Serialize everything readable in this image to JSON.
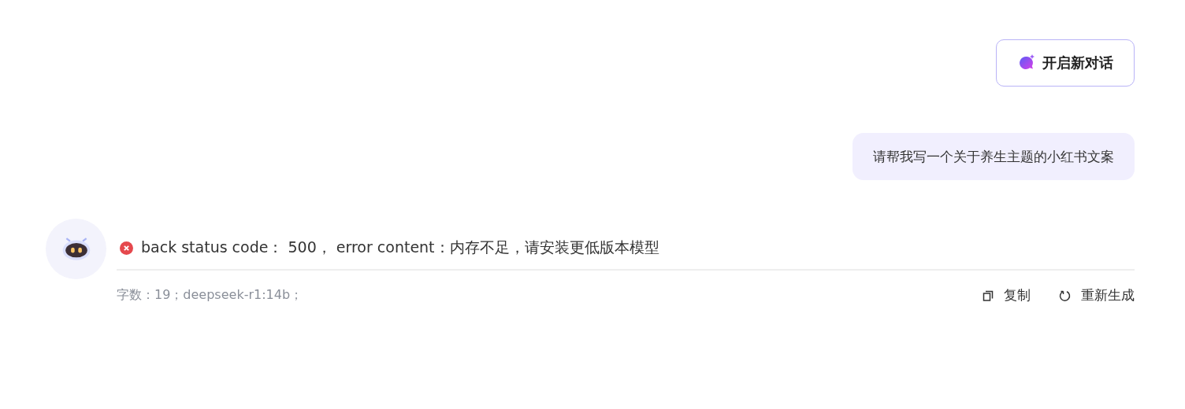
{
  "new_chat_button": {
    "label": "开启新对话"
  },
  "messages": [
    {
      "kind": "user",
      "text": "请帮我写一个关于养生主题的小红书文案"
    },
    {
      "kind": "error",
      "text": "back status code： 500， error content：内存不足，请安装更低版本模型",
      "meta": "字数：19；deepseek-r1:14b；",
      "actions": [
        {
          "kind": "copy",
          "label": "复制"
        },
        {
          "kind": "regenerate",
          "label": "重新生成"
        }
      ]
    }
  ]
}
